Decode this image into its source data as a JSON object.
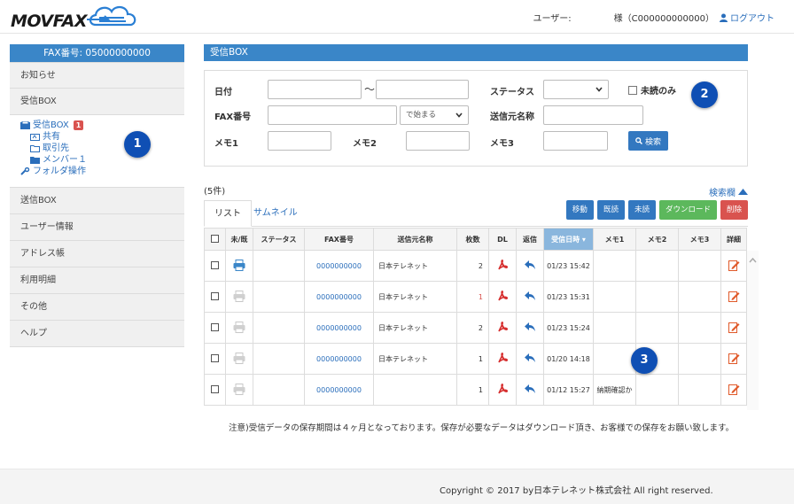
{
  "header": {
    "logo_text": "MOVFAX",
    "user_label": "ユーザー:",
    "user_id": "様（C000000000000）",
    "logout": "ログアウト"
  },
  "sidebar": {
    "fax_number": "FAX番号: 05000000000",
    "items_top": [
      "お知らせ",
      "受信BOX"
    ],
    "tree": {
      "inbox": "受信BOX",
      "inbox_badge": "1",
      "shared": "共有",
      "clients": "取引先",
      "member": "メンバー１",
      "folder_ops": "フォルダ操作"
    },
    "items_bottom": [
      "送信BOX",
      "ユーザー情報",
      "アドレス帳",
      "利用明細",
      "その他",
      "ヘルプ"
    ]
  },
  "main": {
    "title": "受信BOX"
  },
  "search": {
    "date_label": "日付",
    "date_sep": "〜",
    "status_label": "ステータス",
    "unread_only": "未読のみ",
    "fax_label": "FAX番号",
    "fax_match": "で始まる",
    "sender_label": "送信元名称",
    "memo1_label": "メモ1",
    "memo2_label": "メモ2",
    "memo3_label": "メモ3",
    "search_button": "検索"
  },
  "list": {
    "count": "(5件)",
    "search_toggle": "検索欄",
    "tab_list": "リスト",
    "tab_thumb": "サムネイル",
    "buttons": [
      {
        "label": "移動",
        "color": "#3378c0"
      },
      {
        "label": "既読",
        "color": "#3378c0"
      },
      {
        "label": "未読",
        "color": "#3378c0"
      },
      {
        "label": "ダウンロード",
        "color": "#5cb85c"
      },
      {
        "label": "削除",
        "color": "#d9534f"
      }
    ],
    "columns": [
      "未/既",
      "ステータス",
      "FAX番号",
      "送信元名称",
      "枚数",
      "DL",
      "返信",
      "受信日時",
      "メモ1",
      "メモ2",
      "メモ3",
      "詳細"
    ],
    "sort_indicator": "▾",
    "rows": [
      {
        "unread": true,
        "fax": "0000000000",
        "sender": "日本テレネット",
        "pages": "2",
        "red_pages": false,
        "received": "01/23 15:42",
        "memo1": ""
      },
      {
        "unread": false,
        "fax": "0000000000",
        "sender": "日本テレネット",
        "pages": "1",
        "red_pages": true,
        "received": "01/23 15:31",
        "memo1": ""
      },
      {
        "unread": false,
        "fax": "0000000000",
        "sender": "日本テレネット",
        "pages": "2",
        "red_pages": false,
        "received": "01/23 15:24",
        "memo1": ""
      },
      {
        "unread": false,
        "fax": "0000000000",
        "sender": "日本テレネット",
        "pages": "1",
        "red_pages": false,
        "received": "01/20 14:18",
        "memo1": ""
      },
      {
        "unread": false,
        "fax": "0000000000",
        "sender": "",
        "pages": "1",
        "red_pages": false,
        "received": "01/12 15:27",
        "memo1": "納期確認か"
      }
    ]
  },
  "callouts": [
    "1",
    "2",
    "3"
  ],
  "notice": "注意)受信データの保存期間は４ヶ月となっております。保存が必要なデータはダウンロード頂き、お客様での保存をお願い致します。",
  "footer": {
    "copyright": "Copyright © 2017 by日本テレネット株式会社 All right reserved."
  }
}
